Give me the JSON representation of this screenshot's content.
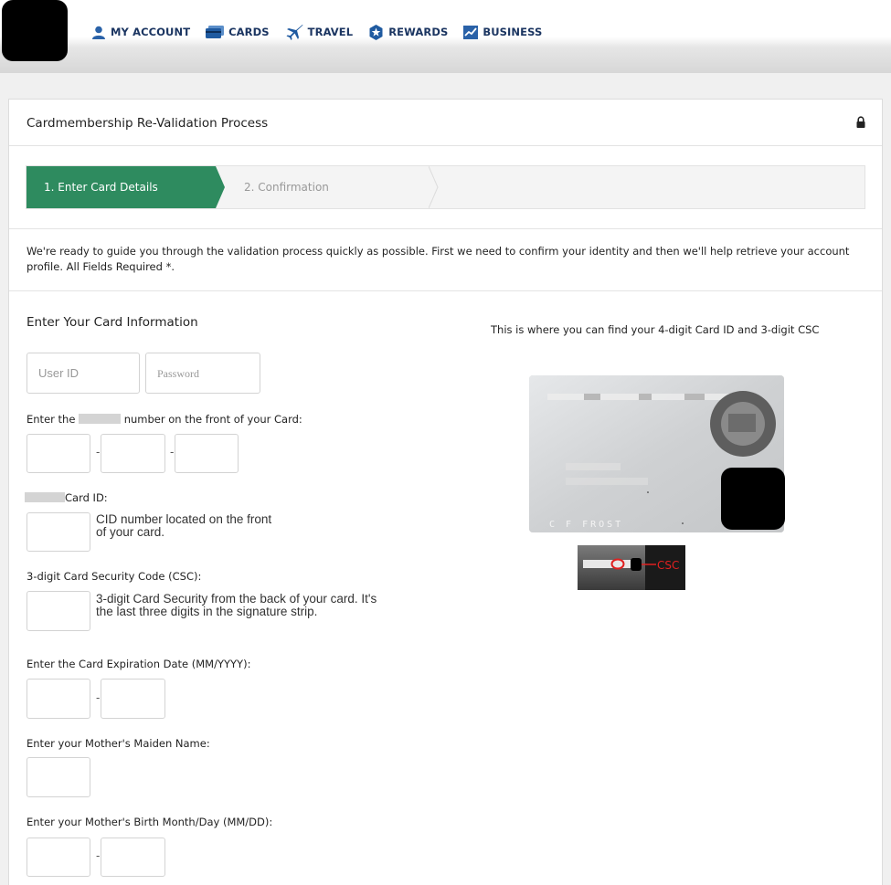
{
  "nav": {
    "items": [
      {
        "label": "MY ACCOUNT",
        "icon": "user-icon"
      },
      {
        "label": "CARDS",
        "icon": "card-icon"
      },
      {
        "label": "TRAVEL",
        "icon": "plane-icon"
      },
      {
        "label": "REWARDS",
        "icon": "star-badge-icon"
      },
      {
        "label": "BUSINESS",
        "icon": "chart-icon"
      }
    ]
  },
  "colors": {
    "nav_text": "#1b3561",
    "step_active": "#2e8b5f",
    "csc_red": "#e02020"
  },
  "panel": {
    "title": "Cardmembership Re-Validation Process"
  },
  "steps": {
    "step1": "1. Enter Card Details",
    "step2": "2. Confirmation"
  },
  "intro": "We're ready to guide you through the validation process quickly as possible. First we need to confirm your identity and then we'll help retrieve your account profile. All Fields Required *.",
  "form": {
    "section_title": "Enter Your Card Information",
    "user_id_placeholder": "User ID",
    "password_placeholder": "Password",
    "card_number_label_pre": "Enter the",
    "card_number_label_post": "number on the front of your Card:",
    "dash": "-",
    "card_id_label": "Card ID:",
    "cid_hint_line1": "CID number located on the front",
    "cid_hint_line2": "of your card.",
    "csc_label": "3-digit Card Security Code (CSC):",
    "csc_hint_line1": "3-digit Card Security from the back of your card. It's",
    "csc_hint_line2": "the last three digits in the signature strip.",
    "expiry_label": "Enter the Card Expiration Date (MM/YYYY):",
    "maiden_label": "Enter your Mother's Maiden Name:",
    "birth_label": "Enter your Mother's Birth Month/Day (MM/DD):"
  },
  "card_help": {
    "where_text": "This is where you can find your 4-digit Card ID and 3-digit CSC",
    "card_name": "C F FROST",
    "csc_tag": "CSC"
  }
}
